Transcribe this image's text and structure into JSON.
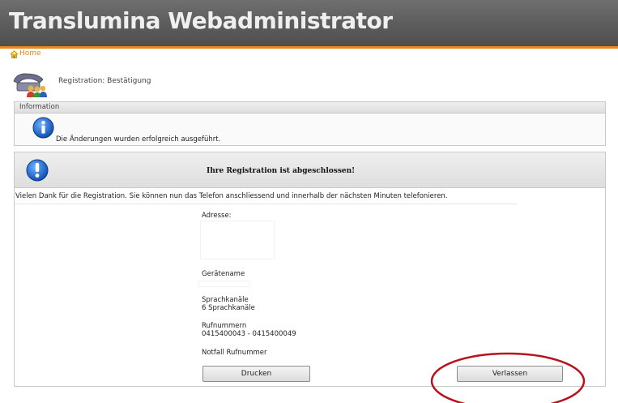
{
  "app": {
    "title": "Translumina Webadministrator"
  },
  "breadcrumb": {
    "home_label": "Home"
  },
  "page": {
    "heading": "Registration: Bestätigung"
  },
  "info_box": {
    "header": "Information",
    "message": "Die Änderungen wurden erfolgreich ausgeführt."
  },
  "registration": {
    "title": "Ihre Registration ist abgeschlossen!",
    "thanks": "Vielen Dank für die Registration. Sie können nun das Telefon anschliessend und innerhalb der nächsten Minuten telefonieren.",
    "fields": {
      "address_label": "Adresse:",
      "device_label": "Gerätename",
      "channels_label": "Sprachkanäle",
      "channels_value": "6 Sprachkanäle",
      "numbers_label": "Rufnummern",
      "numbers_value": "0415400043 - 0415400049",
      "emergency_label": "Notfall Rufnummer"
    },
    "buttons": {
      "print": "Drucken",
      "leave": "Verlassen"
    }
  },
  "colors": {
    "accent_orange": "#e98a1a",
    "header_gray": "#5f5f5f",
    "icon_blue": "#1a64c8",
    "annotation_red": "#b8121c"
  },
  "icons": [
    "home-icon",
    "phone-users-icon",
    "info-icon",
    "exclamation-icon"
  ]
}
